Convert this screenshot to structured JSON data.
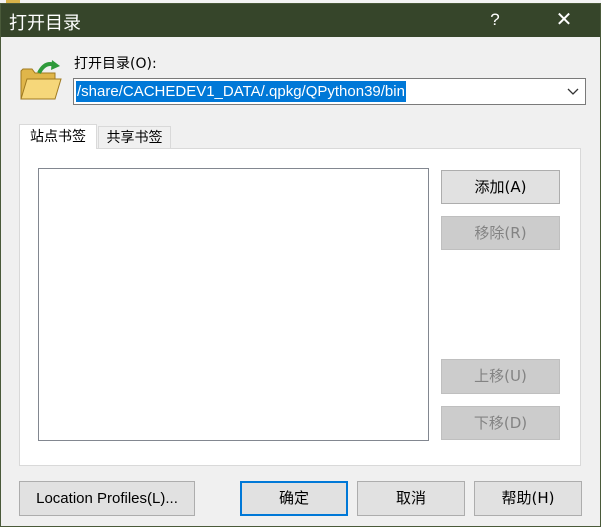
{
  "window": {
    "title": "打开目录",
    "help_glyph": "?",
    "close_glyph": "✕"
  },
  "directory": {
    "label": "打开目录(O):",
    "path": "/share/CACHEDEV1_DATA/.qpkg/QPython39/bin"
  },
  "tabs": [
    {
      "label": "站点书签",
      "active": true
    },
    {
      "label": "共享书签",
      "active": false
    }
  ],
  "bookmarks": {
    "items": [],
    "buttons": {
      "add": "添加(A)",
      "remove": "移除(R)",
      "move_up": "上移(U)",
      "move_down": "下移(D)"
    }
  },
  "footer": {
    "profiles": "Location Profiles(L)...",
    "ok": "确定",
    "cancel": "取消",
    "help": "帮助(H)"
  },
  "colors": {
    "titlebar": "#36452a",
    "selection": "#0078d7",
    "dialog_bg": "#f0f0f0"
  },
  "icons": {
    "folder": "open-folder-icon",
    "dropdown": "chevron-down-icon"
  }
}
